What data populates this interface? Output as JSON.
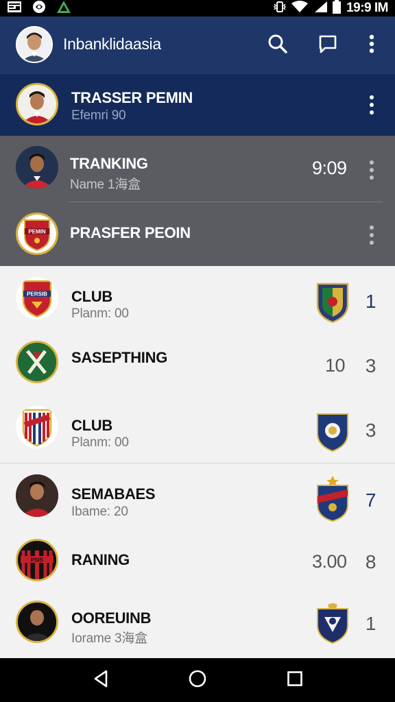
{
  "app": {
    "title": "Inbanklidaasia"
  },
  "status_bar": {
    "time": "19:9 IM",
    "icons": [
      "image-icon",
      "app-icon",
      "logo-icon"
    ]
  },
  "app_bar": {
    "icons": [
      "search-icon",
      "chat-icon",
      "more-icon"
    ]
  },
  "header_rows": [
    {
      "title": "TRASSER PEMIN",
      "subtitle": "Efemri 90",
      "icon": "player-avatar"
    },
    {
      "title": "TRANKING",
      "subtitle": "Name 1海盒",
      "value": "9:09",
      "icon": "player-avatar"
    },
    {
      "title": "PRASFER PEOIN",
      "icon": "club-crest"
    }
  ],
  "list_rows": [
    {
      "title": "CLUB",
      "subtitle": "Planm: 00",
      "rank": "1",
      "rank_color": "#26356b"
    },
    {
      "title": "SASEPTHING",
      "score": "10",
      "rank": "3",
      "rank_color": "#555555"
    },
    {
      "title": "CLUB",
      "subtitle": "Planm: 00",
      "rank": "3",
      "rank_color": "#555555"
    },
    {
      "title": "SEMABAES",
      "subtitle": "Ibame: 20",
      "rank": "7",
      "rank_color": "#26356b"
    },
    {
      "title": "RANING",
      "score": "3.00",
      "rank": "8",
      "rank_color": "#555555"
    },
    {
      "title": "OOREUINB",
      "subtitle": "Iorame 3海盒",
      "rank": "1",
      "rank_color": "#555555"
    }
  ],
  "nav": {
    "icons": [
      "back-icon",
      "home-icon",
      "recents-icon"
    ]
  }
}
